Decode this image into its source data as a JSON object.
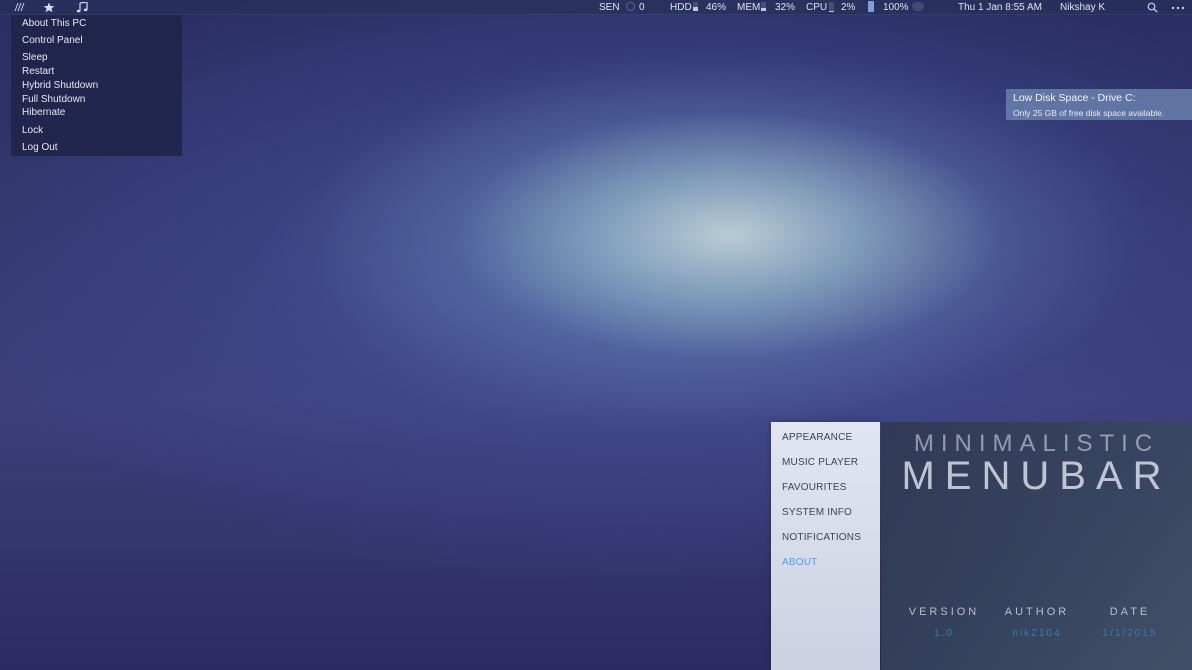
{
  "menubar": {
    "icons": [
      "stripes-icon",
      "star-icon",
      "music-note-icon",
      "search-icon",
      "more-dots-icon"
    ],
    "sen_label": "SEN",
    "sen_value": "0",
    "hdd_label": "HDD",
    "hdd_value": "46%",
    "hdd_fraction": 0.46,
    "mem_label": "MEM",
    "mem_value": "32%",
    "mem_fraction": 0.32,
    "cpu_label": "CPU",
    "cpu_value": "2%",
    "cpu_fraction": 0.02,
    "battery_value": "100%",
    "datetime": "Thu 1 Jan  8:55 AM",
    "user": "Nikshay K"
  },
  "power_menu": {
    "items": [
      {
        "label": "About This PC"
      },
      {
        "label": "Control Panel"
      },
      {
        "label": "Sleep"
      },
      {
        "label": "Restart"
      },
      {
        "label": "Hybrid Shutdown"
      },
      {
        "label": "Full Shutdown"
      },
      {
        "label": "Hibernate"
      },
      {
        "label": "Lock"
      },
      {
        "label": "Log Out"
      }
    ]
  },
  "notification": {
    "title": "Low Disk Space - Drive C:",
    "body": "Only 25 GB of free disk space available."
  },
  "settings": {
    "nav": [
      {
        "label": "APPEARANCE",
        "active": false
      },
      {
        "label": "MUSIC PLAYER",
        "active": false
      },
      {
        "label": "FAVOURITES",
        "active": false
      },
      {
        "label": "SYSTEM INFO",
        "active": false
      },
      {
        "label": "NOTIFICATIONS",
        "active": false
      },
      {
        "label": "ABOUT",
        "active": true
      }
    ],
    "active_color": "#4aa3e6"
  },
  "about": {
    "title_line1": "MINIMALISTIC",
    "title_line2": "MENUBAR",
    "version_label": "VERSION",
    "version_value": "1.0",
    "author_label": "AUTHOR",
    "author_value": "nik2104",
    "date_label": "DATE",
    "date_value": "1/1/2015",
    "value_color": "#2f7fb5"
  }
}
